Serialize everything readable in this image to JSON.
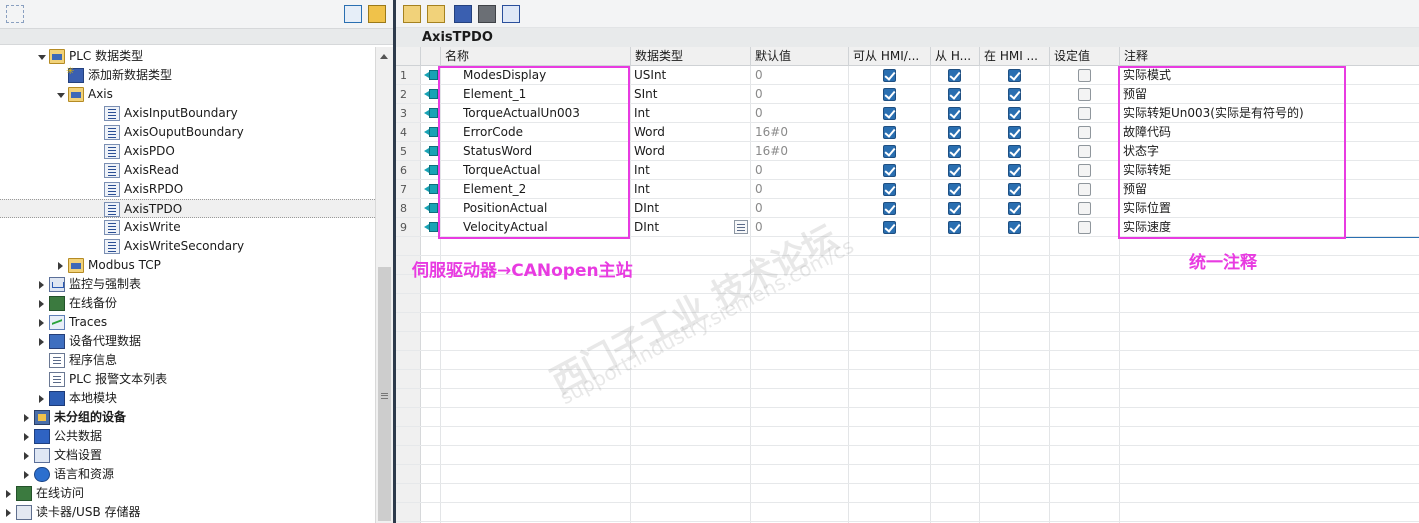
{
  "left_panel": {
    "tree": [
      {
        "label": "PLC 数据类型",
        "icon": "folder-icon",
        "expand": "down",
        "level": 3
      },
      {
        "label": "添加新数据类型",
        "icon": "add-type-icon",
        "expand": "none",
        "level": 4
      },
      {
        "label": "Axis",
        "icon": "folder-icon",
        "expand": "down",
        "level": 4
      },
      {
        "label": "AxisInputBoundary",
        "icon": "data-type-icon",
        "expand": "none",
        "level": 5
      },
      {
        "label": "AxisOuputBoundary",
        "icon": "data-type-icon",
        "expand": "none",
        "level": 5
      },
      {
        "label": "AxisPDO",
        "icon": "data-type-icon",
        "expand": "none",
        "level": 5
      },
      {
        "label": "AxisRead",
        "icon": "data-type-icon",
        "expand": "none",
        "level": 5
      },
      {
        "label": "AxisRPDO",
        "icon": "data-type-icon",
        "expand": "none",
        "level": 5
      },
      {
        "label": "AxisTPDO",
        "icon": "data-type-icon",
        "expand": "none",
        "level": 5,
        "selected": true
      },
      {
        "label": "AxisWrite",
        "icon": "data-type-icon",
        "expand": "none",
        "level": 5
      },
      {
        "label": "AxisWriteSecondary",
        "icon": "data-type-icon",
        "expand": "none",
        "level": 5
      },
      {
        "label": "Modbus TCP",
        "icon": "folder-icon",
        "expand": "right",
        "level": 4
      },
      {
        "label": "监控与强制表",
        "icon": "monitor-icon",
        "expand": "right",
        "level": 3
      },
      {
        "label": "在线备份",
        "icon": "online-backup-icon",
        "expand": "right",
        "level": 3
      },
      {
        "label": "Traces",
        "icon": "trace-icon",
        "expand": "right",
        "level": 3
      },
      {
        "label": "设备代理数据",
        "icon": "device-proxy-icon",
        "expand": "right",
        "level": 3
      },
      {
        "label": "程序信息",
        "icon": "program-info-icon",
        "expand": "none",
        "level": 3
      },
      {
        "label": "PLC 报警文本列表",
        "icon": "alarm-text-icon",
        "expand": "none",
        "level": 3
      },
      {
        "label": "本地模块",
        "icon": "local-module-icon",
        "expand": "right",
        "level": 3
      },
      {
        "label": "未分组的设备",
        "icon": "ungrouped-devices-icon",
        "expand": "right",
        "level": 2,
        "bold": true
      },
      {
        "label": "公共数据",
        "icon": "common-data-icon",
        "expand": "right",
        "level": 2
      },
      {
        "label": "文档设置",
        "icon": "document-settings-icon",
        "expand": "right",
        "level": 2
      },
      {
        "label": "语言和资源",
        "icon": "languages-icon",
        "expand": "right",
        "level": 2
      },
      {
        "label": "在线访问",
        "icon": "online-access-icon",
        "expand": "right",
        "level": 1
      },
      {
        "label": "读卡器/USB 存储器",
        "icon": "card-reader-icon",
        "expand": "right",
        "level": 1
      }
    ]
  },
  "editor": {
    "title": "AxisTPDO",
    "columns": {
      "name": "名称",
      "datatype": "数据类型",
      "default": "默认值",
      "hmi_access": "可从 HMI/...",
      "hmi_visible": "从 H...",
      "hmi_writable": "在 HMI ...",
      "setpoint": "设定值",
      "comment": "注释"
    },
    "rows": [
      {
        "num": "1",
        "name": "ModesDisplay",
        "datatype": "USInt",
        "default": "0",
        "hmi_access": true,
        "hmi_visible": true,
        "hmi_writable": true,
        "setpoint": false,
        "comment": "实际模式"
      },
      {
        "num": "2",
        "name": "Element_1",
        "datatype": "SInt",
        "default": "0",
        "hmi_access": true,
        "hmi_visible": true,
        "hmi_writable": true,
        "setpoint": false,
        "comment": "预留"
      },
      {
        "num": "3",
        "name": "TorqueActualUn003",
        "datatype": "Int",
        "default": "0",
        "hmi_access": true,
        "hmi_visible": true,
        "hmi_writable": true,
        "setpoint": false,
        "comment": "实际转矩Un003(实际是有符号的)"
      },
      {
        "num": "4",
        "name": "ErrorCode",
        "datatype": "Word",
        "default": "16#0",
        "hmi_access": true,
        "hmi_visible": true,
        "hmi_writable": true,
        "setpoint": false,
        "comment": "故障代码"
      },
      {
        "num": "5",
        "name": "StatusWord",
        "datatype": "Word",
        "default": "16#0",
        "hmi_access": true,
        "hmi_visible": true,
        "hmi_writable": true,
        "setpoint": false,
        "comment": "状态字"
      },
      {
        "num": "6",
        "name": "TorqueActual",
        "datatype": "Int",
        "default": "0",
        "hmi_access": true,
        "hmi_visible": true,
        "hmi_writable": true,
        "setpoint": false,
        "comment": "实际转矩"
      },
      {
        "num": "7",
        "name": "Element_2",
        "datatype": "Int",
        "default": "0",
        "hmi_access": true,
        "hmi_visible": true,
        "hmi_writable": true,
        "setpoint": false,
        "comment": "预留"
      },
      {
        "num": "8",
        "name": "PositionActual",
        "datatype": "DInt",
        "default": "0",
        "hmi_access": true,
        "hmi_visible": true,
        "hmi_writable": true,
        "setpoint": false,
        "comment": "实际位置"
      },
      {
        "num": "9",
        "name": "VelocityActual",
        "datatype": "DInt",
        "default": "0",
        "hmi_access": true,
        "hmi_visible": true,
        "hmi_writable": true,
        "setpoint": false,
        "comment": "实际速度"
      }
    ]
  },
  "annotations": {
    "left_note": "伺服驱动器→CANopen主站",
    "right_note": "统一注释",
    "color": "#e83be1"
  },
  "watermark": {
    "line1": "西门子工业 技术论坛",
    "line2": "support.industry.siemens.com/cs"
  },
  "colors": {
    "accent": "#2a6fb1",
    "divider": "#2d3a4b",
    "io_icon": "#19a3b5"
  }
}
